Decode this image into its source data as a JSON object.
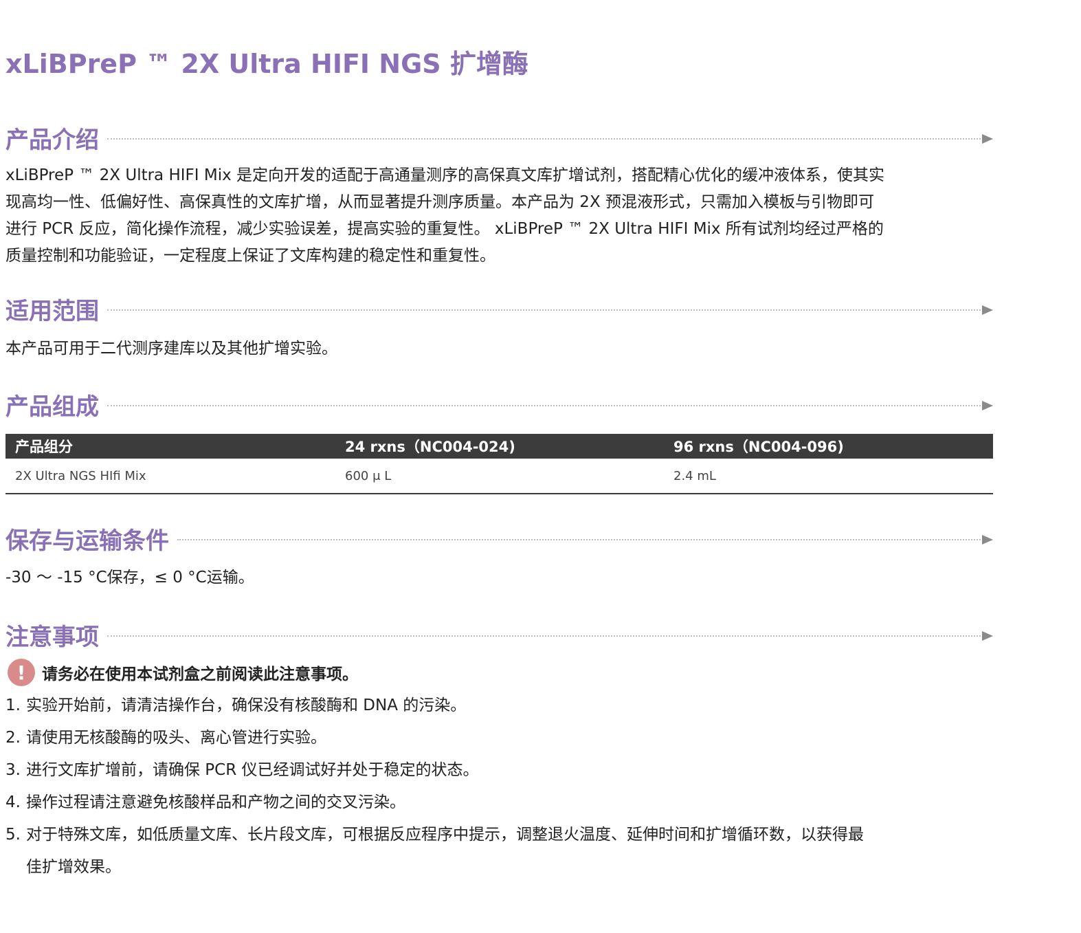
{
  "title": "xLiBPreP ™ 2X Ultra HIFI NGS 扩增酶",
  "sections": {
    "intro": {
      "heading": "产品介绍",
      "lines": [
        "xLiBPreP ™ 2X Ultra HIFI Mix 是定向开发的适配于高通量测序的高保真文库扩增试剂，搭配精心优化的缓冲液体系，使其实",
        "现高均一性、低偏好性、高保真性的文库扩增，从而显著提升测序质量。本产品为 2X 预混液形式，只需加入模板与引物即可",
        "进行 PCR 反应，简化操作流程，减少实验误差，提高实验的重复性。 xLiBPreP ™ 2X Ultra HIFI Mix 所有试剂均经过严格的",
        "质量控制和功能验证，一定程度上保证了文库构建的稳定性和重复性。"
      ]
    },
    "scope": {
      "heading": "适用范围",
      "text": "本产品可用于二代测序建库以及其他扩增实验。"
    },
    "composition": {
      "heading": "产品组成",
      "columns": [
        "产品组分",
        "24 rxns（NC004-024)",
        "96 rxns（NC004-096)"
      ],
      "rows": [
        [
          "2X Ultra NGS HIfi Mix",
          "600 μ L",
          "2.4 mL"
        ]
      ]
    },
    "storage": {
      "heading": "保存与运输条件",
      "text": "-30 ～ -15 °C保存，≤ 0 °C运输。"
    },
    "notes": {
      "heading": "注意事项",
      "warning": "请务必在使用本试剂盒之前阅读此注意事项。",
      "warning_icon": "exclamation-icon",
      "items": [
        {
          "num": "1.",
          "text": "实验开始前，请清洁操作台，确保没有核酸酶和 DNA 的污染。"
        },
        {
          "num": "2.",
          "text": "请使用无核酸酶的吸头、离心管进行实验。"
        },
        {
          "num": "3.",
          "text": "进行文库扩增前，请确保 PCR 仪已经调试好并处于稳定的状态。"
        },
        {
          "num": "4.",
          "text": "操作过程请注意避免核酸样品和产物之间的交叉污染。"
        },
        {
          "num": "5.",
          "text": "对于特殊文库，如低质量文库、长片段文库，可根据反应程序中提示，调整退火温度、延伸时间和扩增循环数，以获得最",
          "cont": "佳扩增效果。"
        }
      ]
    }
  },
  "colors": {
    "accent": "#8a70b4",
    "table_header": "#3c3c3c",
    "warning_icon": "#d98b8b"
  }
}
